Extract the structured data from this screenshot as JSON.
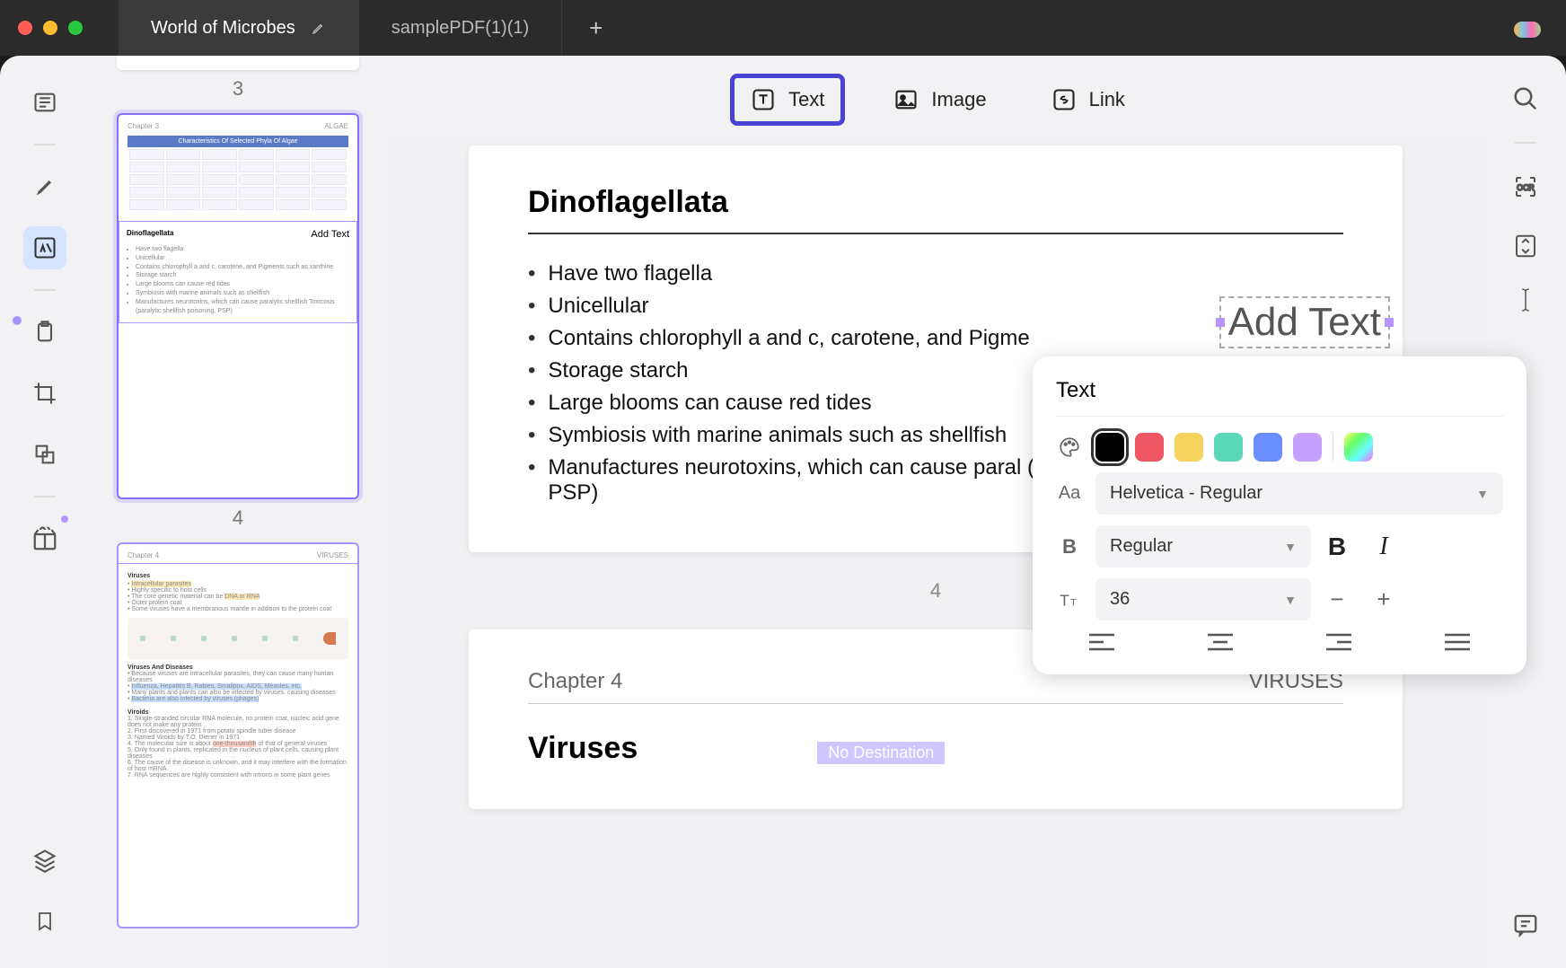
{
  "tabs": {
    "active": "World of Microbes",
    "second": "samplePDF(1)(1)"
  },
  "toolbar": {
    "text": "Text",
    "image": "Image",
    "link": "Link"
  },
  "thumbs": {
    "page3_num": "3",
    "page4_num": "4",
    "p4_chapter": "Chapter 3",
    "p4_right": "ALGAE",
    "p4_table_title": "Characteristics Of Selected Phyla Of Algae",
    "p4_dino_title": "Dinoflagellata",
    "p4_addtext": "Add Text",
    "p4_bullets": [
      "Have two flagella",
      "Unicellular",
      "Contains chlorophyll a and c, carotene, and Pigments such as xanthine",
      "Storage starch",
      "Large blooms can cause red tides",
      "Symbiosis with marine animals such as shellfish",
      "Manufactures neurotoxins, which can cause paralytic shellfish Toxicosis (paralytic shellfish poisoning, PSP)"
    ],
    "p5_chapter": "Chapter 4",
    "p5_right": "VIRUSES",
    "p5_sec1": "Viruses",
    "p5_sec2": "Viruses And Diseases",
    "p5_sec3": "Viroids"
  },
  "document": {
    "title": "Dinoflagellata",
    "add_text": "Add Text",
    "bullets": [
      "Have two flagella",
      "Unicellular",
      "Contains chlorophyll a and c, carotene, and Pigme",
      "Storage starch",
      "Large blooms can cause red tides",
      "Symbiosis with marine animals such as shellfish",
      "Manufactures neurotoxins, which can cause paral (paralytic shellfish poisoning, PSP)"
    ],
    "page_num": "4",
    "next_chapter": "Chapter 4",
    "next_right": "VIRUSES",
    "next_title": "Viruses",
    "no_destination": "No Destination"
  },
  "popover": {
    "title": "Text",
    "font": "Helvetica - Regular",
    "weight": "Regular",
    "size": "36",
    "colors": [
      "black",
      "red",
      "yellow",
      "teal",
      "blue",
      "purple",
      "rainbow"
    ]
  }
}
